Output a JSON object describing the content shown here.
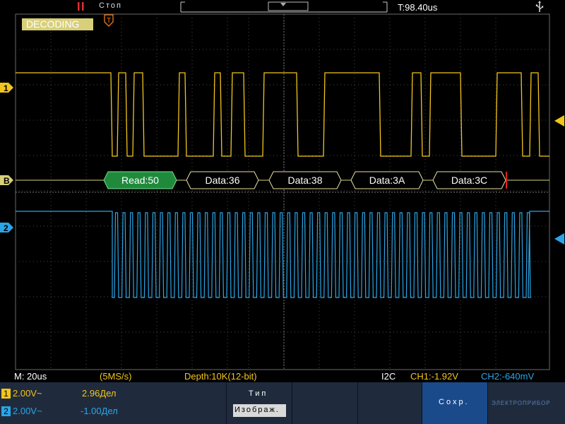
{
  "status": {
    "run_state": "Стоп",
    "trigger_time": "T:98.40us"
  },
  "decoding_badge": "DECODING",
  "trigger_marker": "T",
  "channel_markers": {
    "ch1": "1",
    "bus": "B",
    "ch2": "2"
  },
  "decode_packets": [
    {
      "label": "Read:50",
      "type": "address"
    },
    {
      "label": "Data:36",
      "type": "data"
    },
    {
      "label": "Data:38",
      "type": "data"
    },
    {
      "label": "Data:3A",
      "type": "data"
    },
    {
      "label": "Data:3C",
      "type": "data"
    }
  ],
  "bottom_info": {
    "timebase": "M: 20us",
    "sample_rate": "(5MS/s)",
    "depth": "Depth:10K(12-bit)",
    "protocol": "I2C",
    "ch1_level": "CH1:-1.92V",
    "ch2_level": "CH2:-640mV"
  },
  "panel": {
    "ch1_num": "1",
    "ch1_scale": "2.00V~",
    "ch1_pos": "2.96Дел",
    "ch2_num": "2",
    "ch2_scale": "2.00V~",
    "ch2_pos": "-1.00Дел",
    "type_label": "Тип",
    "type_button": "Изображ.",
    "save_button": "Сохр.",
    "watermark": "ЭЛЕКТРОПРИБОР"
  },
  "colors": {
    "ch1": "#f2c51b",
    "ch2": "#2aa6e8",
    "decode_address": "#1f8a3c",
    "grid": "#4a4a4a",
    "panel_bg": "#1f2b3d"
  }
}
